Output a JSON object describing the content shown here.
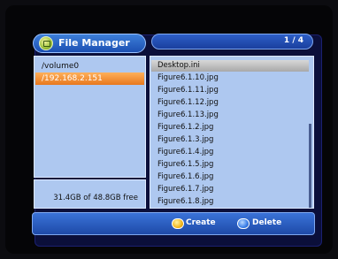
{
  "colors": {
    "accent_blue": "#2d5fc7",
    "panel_bg": "#aec8f0",
    "selection_orange": "#f0902e",
    "create_button_yellow": "#f0b61e",
    "delete_button_blue": "#3a7ee8"
  },
  "header": {
    "title": "File Manager",
    "icon": "folder-app-icon",
    "page_indicator": "1 / 4"
  },
  "left_panel": {
    "items": [
      {
        "label": "/volume0",
        "selected": false
      },
      {
        "label": "/192.168.2.151",
        "selected": true
      }
    ],
    "free_space": "31.4GB of 48.8GB free"
  },
  "file_list": {
    "items": [
      {
        "label": "Desktop.ini",
        "selected": true
      },
      {
        "label": "Figure6.1.10.jpg",
        "selected": false
      },
      {
        "label": "Figure6.1.11.jpg",
        "selected": false
      },
      {
        "label": "Figure6.1.12.jpg",
        "selected": false
      },
      {
        "label": "Figure6.1.13.jpg",
        "selected": false
      },
      {
        "label": "Figure6.1.2.jpg",
        "selected": false
      },
      {
        "label": "Figure6.1.3.jpg",
        "selected": false
      },
      {
        "label": "Figure6.1.4.jpg",
        "selected": false
      },
      {
        "label": "Figure6.1.5.jpg",
        "selected": false
      },
      {
        "label": "Figure6.1.6.jpg",
        "selected": false
      },
      {
        "label": "Figure6.1.7.jpg",
        "selected": false
      },
      {
        "label": "Figure6.1.8.jpg",
        "selected": false
      }
    ]
  },
  "bottom_bar": {
    "create_label": "Create",
    "create_icon": "yellow-button-icon",
    "delete_label": "Delete",
    "delete_icon": "blue-button-icon"
  }
}
